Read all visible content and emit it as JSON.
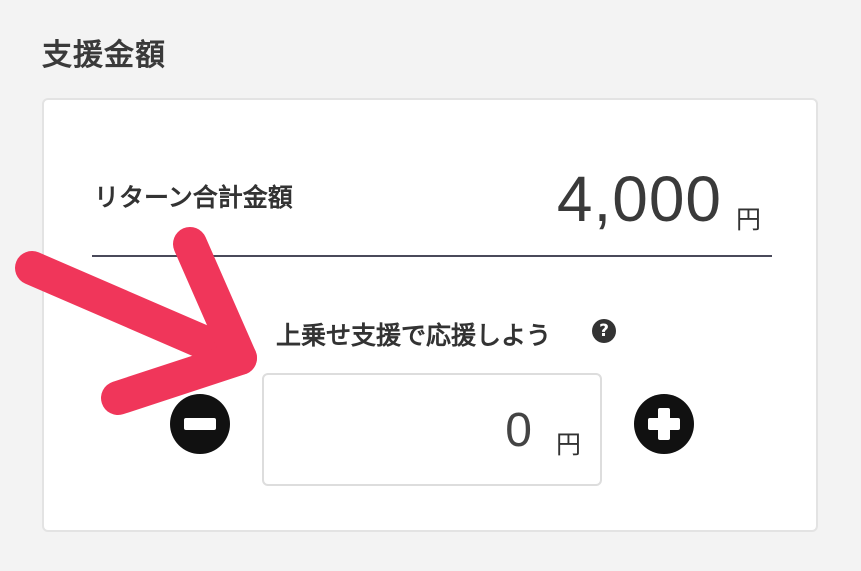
{
  "section": {
    "title": "支援金額"
  },
  "total": {
    "label": "リターン合計金額",
    "amount": "4,000",
    "unit": "円"
  },
  "extra": {
    "label": "上乗せ支援で応援しよう",
    "help_icon": "question-circle-icon",
    "help_glyph": "?",
    "value": "0",
    "unit": "円",
    "minus_icon": "minus-circle-icon",
    "plus_icon": "plus-circle-icon"
  },
  "annotation": {
    "icon": "arrow-icon",
    "color": "#f0365a"
  }
}
